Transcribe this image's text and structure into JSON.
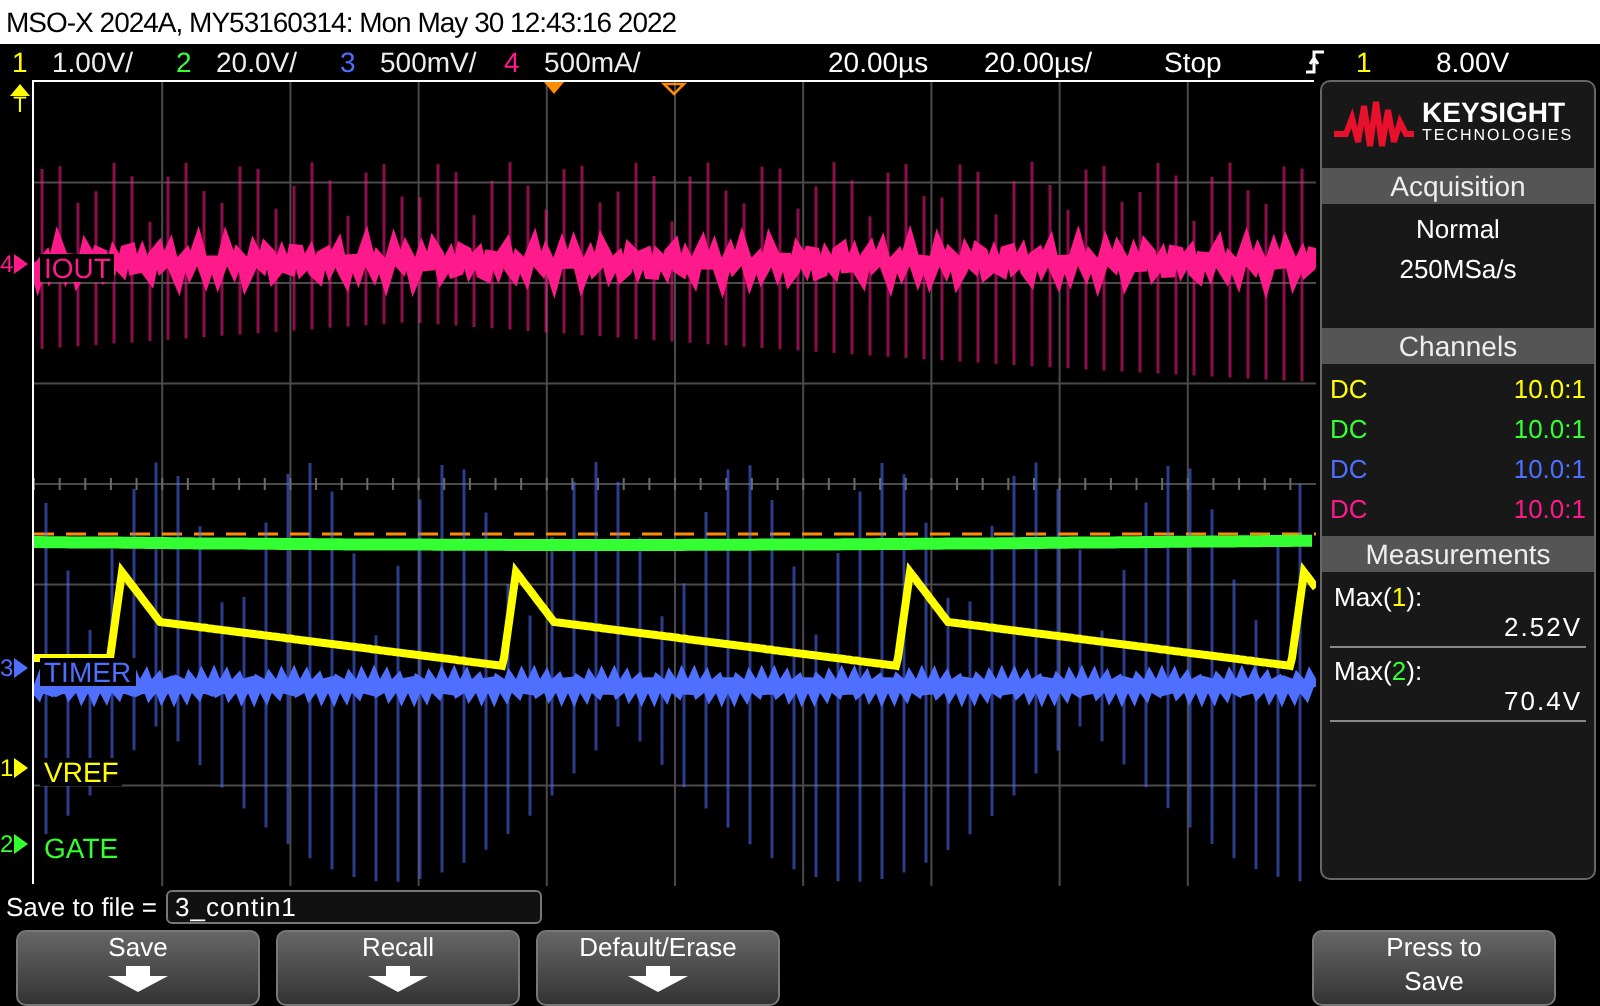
{
  "window": {
    "title": "MSO-X 2024A, MY53160314: Mon May 30 12:43:16 2022"
  },
  "status_bar": {
    "channels": [
      {
        "number": "1",
        "scale": "1.00V/",
        "color": "#ffff00"
      },
      {
        "number": "2",
        "scale": "20.0V/",
        "color": "#33ff33"
      },
      {
        "number": "3",
        "scale": "500mV/",
        "color": "#4f6fff"
      },
      {
        "number": "4",
        "scale": "500mA/",
        "color": "#ff1a8c"
      }
    ],
    "delay": "20.00µs",
    "timebase": "20.00µs/",
    "run_state": "Stop",
    "trigger_source": "1",
    "trigger_level": "8.00V"
  },
  "display": {
    "trigger_marker": "T",
    "traces": [
      {
        "number": "4",
        "label": "IOUT",
        "color": "#ff1a8c"
      },
      {
        "number": "3",
        "label": "TIMER",
        "color": "#4f6fff"
      },
      {
        "number": "1",
        "label": "VREF",
        "color": "#ffff00"
      },
      {
        "number": "2",
        "label": "GATE",
        "color": "#33ff33"
      }
    ]
  },
  "panel": {
    "logo": {
      "brand": "KEYSIGHT",
      "sub": "TECHNOLOGIES"
    },
    "acquisition": {
      "title": "Acquisition",
      "mode": "Normal",
      "sample_rate": "250MSa/s"
    },
    "channels": {
      "title": "Channels",
      "rows": [
        {
          "coupling": "DC",
          "probe": "10.0:1",
          "color": "#ffff00"
        },
        {
          "coupling": "DC",
          "probe": "10.0:1",
          "color": "#33ff33"
        },
        {
          "coupling": "DC",
          "probe": "10.0:1",
          "color": "#4f6fff"
        },
        {
          "coupling": "DC",
          "probe": "10.0:1",
          "color": "#ff1a8c"
        }
      ]
    },
    "measurements": {
      "title": "Measurements",
      "items": [
        {
          "prefix": "Max(",
          "source": "1",
          "suffix": "):",
          "color": "#ffff00",
          "value": "2.52V"
        },
        {
          "prefix": "Max(",
          "source": "2",
          "suffix": "):",
          "color": "#33ff33",
          "value": "70.4V"
        }
      ]
    }
  },
  "save_bar": {
    "label": "Save to file =",
    "value": "3_contin1"
  },
  "softkeys": [
    {
      "kind": "menu",
      "lines": [
        "Save"
      ]
    },
    {
      "kind": "menu",
      "lines": [
        "Recall"
      ]
    },
    {
      "kind": "menu",
      "lines": [
        "Default/Erase"
      ]
    },
    {
      "kind": "action",
      "lines": [
        "Press to",
        "Save"
      ]
    }
  ]
}
